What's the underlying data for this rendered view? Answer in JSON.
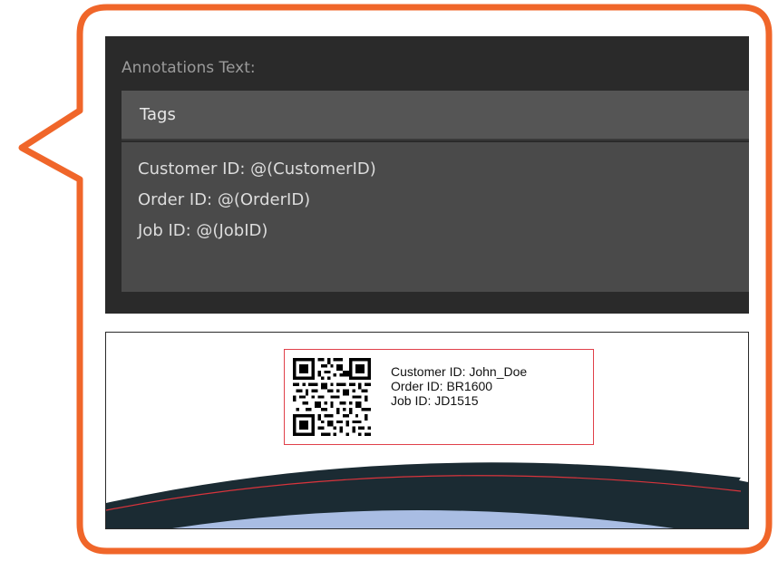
{
  "panel": {
    "label": "Annotations Text:",
    "tags_header": "Tags",
    "lines": [
      "Customer ID: @(CustomerID)",
      "Order ID: @(OrderID)",
      "Job ID: @(JobID)"
    ]
  },
  "preview": {
    "label_lines": [
      "Customer ID: John_Doe",
      "Order ID: BR1600",
      "Job ID: JD1515"
    ],
    "qr_icon": "qr-code-icon"
  },
  "colors": {
    "callout_border": "#f0662a",
    "panel_bg": "#2a2a2a",
    "label_border": "#e0404a",
    "band_dark": "#1b2b33",
    "band_light": "#a9bde3"
  }
}
